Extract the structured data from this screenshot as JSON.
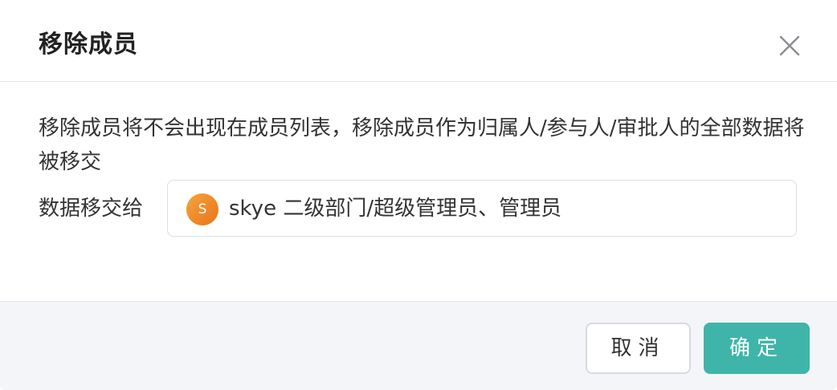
{
  "dialog": {
    "title": "移除成员",
    "close_icon": "close-icon"
  },
  "body": {
    "description": "移除成员将不会出现在成员列表，移除成员作为归属人/参与人/审批人的全部数据将被移交",
    "transfer_label": "数据移交给",
    "selected_user": {
      "avatar_letter": "S",
      "text": "skye 二级部门/超级管理员、管理员"
    }
  },
  "footer": {
    "cancel_label": "取消",
    "confirm_label": "确定"
  },
  "colors": {
    "primary": "#3fb5a9",
    "avatar": "#ee8a2a"
  }
}
